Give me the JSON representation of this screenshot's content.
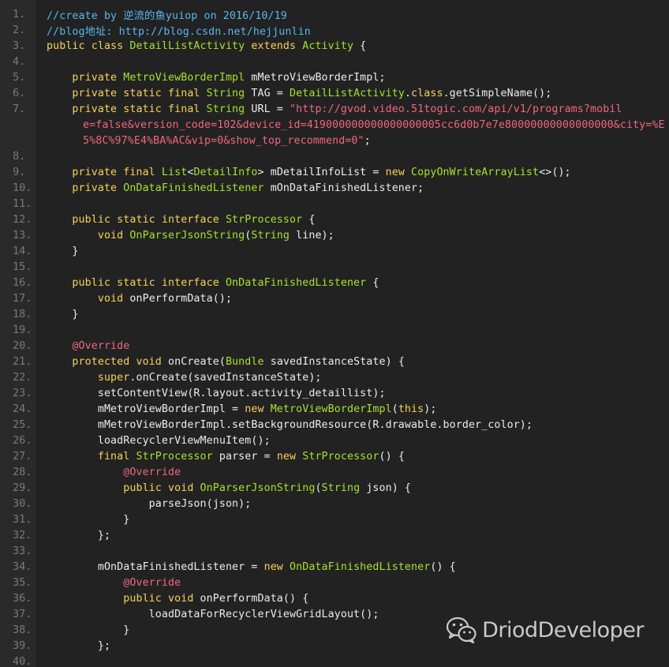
{
  "lines": [
    {
      "num": "1.",
      "tokens": [
        {
          "t": "//create by 逆流的鱼yuiop on 2016/10/19",
          "c": "comment"
        }
      ]
    },
    {
      "num": "2.",
      "tokens": [
        {
          "t": "//blog地址: http://blog.csdn.net/hejjunlin",
          "c": "comment"
        }
      ]
    },
    {
      "num": "3.",
      "tokens": [
        {
          "t": "public class ",
          "c": "keyword"
        },
        {
          "t": "DetailListActivity",
          "c": "type"
        },
        {
          "t": " extends ",
          "c": "keyword"
        },
        {
          "t": "Activity",
          "c": "type"
        },
        {
          "t": " {",
          "c": "plain"
        }
      ]
    },
    {
      "num": "4.",
      "tokens": []
    },
    {
      "num": "5.",
      "tokens": [
        {
          "t": "    private ",
          "c": "keyword"
        },
        {
          "t": "MetroViewBorderImpl",
          "c": "type"
        },
        {
          "t": " mMetroViewBorderImpl;",
          "c": "plain"
        }
      ]
    },
    {
      "num": "6.",
      "tokens": [
        {
          "t": "    private static final ",
          "c": "keyword"
        },
        {
          "t": "String",
          "c": "type"
        },
        {
          "t": " TAG = ",
          "c": "plain"
        },
        {
          "t": "DetailListActivity",
          "c": "type"
        },
        {
          "t": ".",
          "c": "plain"
        },
        {
          "t": "class",
          "c": "keyword"
        },
        {
          "t": ".getSimpleName();",
          "c": "plain"
        }
      ]
    },
    {
      "num": "7.",
      "tokens": [
        {
          "t": "    private static final ",
          "c": "keyword"
        },
        {
          "t": "String",
          "c": "type"
        },
        {
          "t": " URL = ",
          "c": "plain"
        },
        {
          "t": "\"http://gvod.video.51togic.com/api/v1/programs?mobil",
          "c": "string"
        }
      ]
    },
    {
      "num": "",
      "cont": true,
      "tokens": [
        {
          "t": "e=false&version_code=102&device_id=419000000000000000005cc6d0b7e7e80000000000000000&city=%E",
          "c": "string"
        }
      ]
    },
    {
      "num": "",
      "cont": true,
      "tokens": [
        {
          "t": "5%8C%97%E4%BA%AC&vip=0&show_top_recommend=0\"",
          "c": "string"
        },
        {
          "t": ";",
          "c": "plain"
        }
      ]
    },
    {
      "num": "8.",
      "tokens": []
    },
    {
      "num": "9.",
      "tokens": [
        {
          "t": "    private final ",
          "c": "keyword"
        },
        {
          "t": "List",
          "c": "type"
        },
        {
          "t": "<",
          "c": "plain"
        },
        {
          "t": "DetailInfo",
          "c": "type"
        },
        {
          "t": "> mDetailInfoList = ",
          "c": "plain"
        },
        {
          "t": "new ",
          "c": "keyword"
        },
        {
          "t": "CopyOnWriteArrayList",
          "c": "type"
        },
        {
          "t": "<>();",
          "c": "plain"
        }
      ]
    },
    {
      "num": "10.",
      "tokens": [
        {
          "t": "    private ",
          "c": "keyword"
        },
        {
          "t": "OnDataFinishedListener",
          "c": "type"
        },
        {
          "t": " mOnDataFinishedListener;",
          "c": "plain"
        }
      ]
    },
    {
      "num": "11.",
      "tokens": []
    },
    {
      "num": "12.",
      "tokens": [
        {
          "t": "    public static interface ",
          "c": "keyword"
        },
        {
          "t": "StrProcessor",
          "c": "type"
        },
        {
          "t": " {",
          "c": "plain"
        }
      ]
    },
    {
      "num": "13.",
      "tokens": [
        {
          "t": "        void ",
          "c": "keyword"
        },
        {
          "t": "OnParserJsonString",
          "c": "type"
        },
        {
          "t": "(",
          "c": "plain"
        },
        {
          "t": "String",
          "c": "type"
        },
        {
          "t": " line);",
          "c": "plain"
        }
      ]
    },
    {
      "num": "14.",
      "tokens": [
        {
          "t": "    }",
          "c": "plain"
        }
      ]
    },
    {
      "num": "15.",
      "tokens": []
    },
    {
      "num": "16.",
      "tokens": [
        {
          "t": "    public static interface ",
          "c": "keyword"
        },
        {
          "t": "OnDataFinishedListener",
          "c": "type"
        },
        {
          "t": " {",
          "c": "plain"
        }
      ]
    },
    {
      "num": "17.",
      "tokens": [
        {
          "t": "        void ",
          "c": "keyword"
        },
        {
          "t": "onPerformData();",
          "c": "plain"
        }
      ]
    },
    {
      "num": "18.",
      "tokens": [
        {
          "t": "    }",
          "c": "plain"
        }
      ]
    },
    {
      "num": "19.",
      "tokens": []
    },
    {
      "num": "20.",
      "tokens": [
        {
          "t": "    @Override",
          "c": "annotation"
        }
      ]
    },
    {
      "num": "21.",
      "tokens": [
        {
          "t": "    protected void ",
          "c": "keyword"
        },
        {
          "t": "onCreate(",
          "c": "plain"
        },
        {
          "t": "Bundle",
          "c": "type"
        },
        {
          "t": " savedInstanceState) {",
          "c": "plain"
        }
      ]
    },
    {
      "num": "22.",
      "tokens": [
        {
          "t": "        super",
          "c": "keyword"
        },
        {
          "t": ".onCreate(savedInstanceState);",
          "c": "plain"
        }
      ]
    },
    {
      "num": "23.",
      "tokens": [
        {
          "t": "        setContentView(R.layout.activity_detaillist);",
          "c": "plain"
        }
      ]
    },
    {
      "num": "24.",
      "tokens": [
        {
          "t": "        mMetroViewBorderImpl = ",
          "c": "plain"
        },
        {
          "t": "new ",
          "c": "keyword"
        },
        {
          "t": "MetroViewBorderImpl",
          "c": "type"
        },
        {
          "t": "(",
          "c": "plain"
        },
        {
          "t": "this",
          "c": "keyword"
        },
        {
          "t": ");",
          "c": "plain"
        }
      ]
    },
    {
      "num": "25.",
      "tokens": [
        {
          "t": "        mMetroViewBorderImpl.setBackgroundResource(R.drawable.border_color);",
          "c": "plain"
        }
      ]
    },
    {
      "num": "26.",
      "tokens": [
        {
          "t": "        loadRecyclerViewMenuItem();",
          "c": "plain"
        }
      ]
    },
    {
      "num": "27.",
      "tokens": [
        {
          "t": "        final ",
          "c": "keyword"
        },
        {
          "t": "StrProcessor",
          "c": "type"
        },
        {
          "t": " parser = ",
          "c": "plain"
        },
        {
          "t": "new ",
          "c": "keyword"
        },
        {
          "t": "StrProcessor",
          "c": "type"
        },
        {
          "t": "() {",
          "c": "plain"
        }
      ]
    },
    {
      "num": "28.",
      "tokens": [
        {
          "t": "            @Override",
          "c": "annotation"
        }
      ]
    },
    {
      "num": "29.",
      "tokens": [
        {
          "t": "            public void ",
          "c": "keyword"
        },
        {
          "t": "OnParserJsonString",
          "c": "type"
        },
        {
          "t": "(",
          "c": "plain"
        },
        {
          "t": "String",
          "c": "type"
        },
        {
          "t": " json) {",
          "c": "plain"
        }
      ]
    },
    {
      "num": "30.",
      "tokens": [
        {
          "t": "                parseJson(json);",
          "c": "plain"
        }
      ]
    },
    {
      "num": "31.",
      "tokens": [
        {
          "t": "            }",
          "c": "plain"
        }
      ]
    },
    {
      "num": "32.",
      "tokens": [
        {
          "t": "        };",
          "c": "plain"
        }
      ]
    },
    {
      "num": "33.",
      "tokens": []
    },
    {
      "num": "34.",
      "tokens": [
        {
          "t": "        mOnDataFinishedListener = ",
          "c": "plain"
        },
        {
          "t": "new ",
          "c": "keyword"
        },
        {
          "t": "OnDataFinishedListener",
          "c": "type"
        },
        {
          "t": "() {",
          "c": "plain"
        }
      ]
    },
    {
      "num": "35.",
      "tokens": [
        {
          "t": "            @Override",
          "c": "annotation"
        }
      ]
    },
    {
      "num": "36.",
      "tokens": [
        {
          "t": "            public void ",
          "c": "keyword"
        },
        {
          "t": "onPerformData() {",
          "c": "plain"
        }
      ]
    },
    {
      "num": "37.",
      "tokens": [
        {
          "t": "                loadDataForRecyclerViewGridLayout();",
          "c": "plain"
        }
      ]
    },
    {
      "num": "38.",
      "tokens": [
        {
          "t": "            }",
          "c": "plain"
        }
      ]
    },
    {
      "num": "39.",
      "tokens": [
        {
          "t": "        };",
          "c": "plain"
        }
      ]
    },
    {
      "num": "40.",
      "tokens": []
    }
  ],
  "watermark": {
    "text": "DriodDeveloper",
    "icon": "wechat-icon"
  },
  "colors": {
    "background": "#222222",
    "gutter": "#2a2a2a",
    "line_number": "#7a7a7a",
    "keyword": "#f6d357",
    "type": "#a6e22e",
    "plain": "#ececec",
    "string": "#f0677e",
    "comment": "#58b7ed",
    "annotation": "#f0677e"
  }
}
